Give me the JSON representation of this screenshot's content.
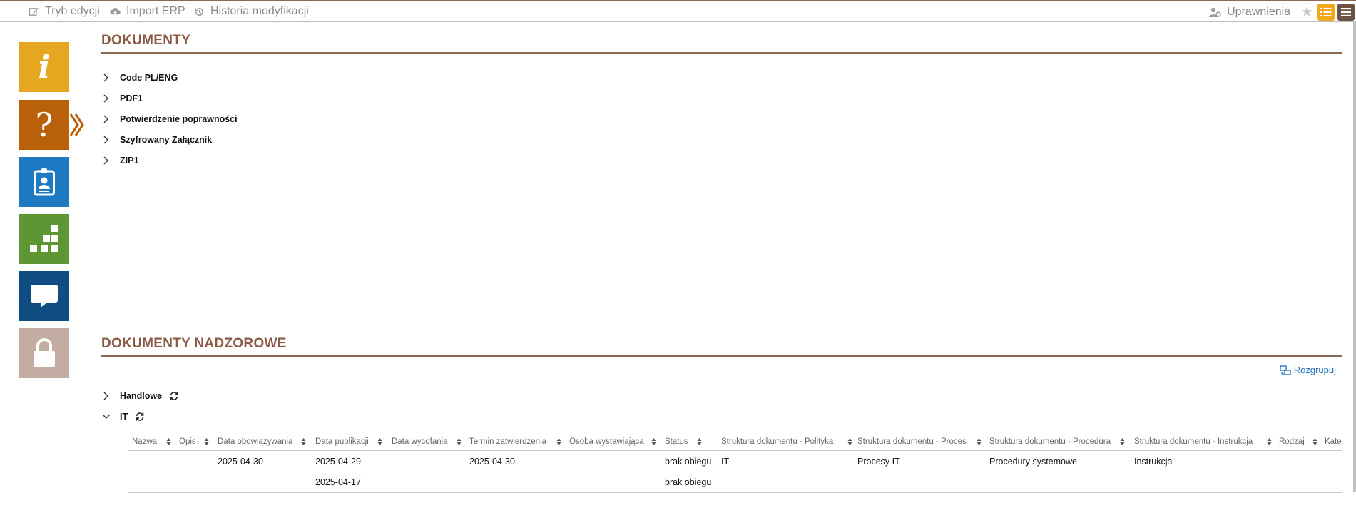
{
  "toolbar": {
    "edit_mode": "Tryb edycji",
    "import_erp": "Import ERP",
    "history": "Historia modyfikacji",
    "permissions": "Uprawnienia"
  },
  "colors": {
    "accent_brown": "#8a5a45",
    "tile_info": "#e6a620",
    "tile_help": "#b8610a",
    "tile_badge": "#1f7ac4",
    "tile_steps": "#5d9632",
    "tile_chat": "#0f4d82",
    "tile_lock": "#c3aca2",
    "link_blue": "#1f6fbf"
  },
  "sidebar": {
    "icons": [
      "info-icon",
      "help-icon",
      "badge-icon",
      "steps-icon",
      "chat-icon",
      "lock-icon"
    ],
    "info_glyph": "i",
    "help_glyph": "?"
  },
  "documents": {
    "title": "DOKUMENTY",
    "items": [
      "Code PL/ENG",
      "PDF1",
      "Potwierdzenie poprawności",
      "Szyfrowany Załącznik",
      "ZIP1"
    ]
  },
  "supervisory": {
    "title": "DOKUMENTY NADZOROWE",
    "ungroup_label": "Rozgrupuj",
    "groups": [
      {
        "label": "Handlowe",
        "expanded": false
      },
      {
        "label": "IT",
        "expanded": true
      }
    ],
    "columns": [
      "Nazwa",
      "Opis",
      "Data obowiązywania",
      "Data publikacji",
      "Data wycofania",
      "Termin zatwierdzenia",
      "Osoba wystawiająca",
      "Status",
      "Struktura dokumentu - Polityka",
      "Struktura dokumentu - Proces",
      "Struktura dokumentu - Procedura",
      "Struktura dokumentu - Instrukcja",
      "Rodzaj",
      "Kate"
    ],
    "rows": [
      {
        "data_obowiazywania": "2025-04-30",
        "data_publikacji": "2025-04-29",
        "termin_zatwierdzenia": "2025-04-30",
        "status": "brak obiegu",
        "polityka": "IT",
        "proces": "Procesy IT",
        "procedura": "Procedury systemowe",
        "instrukcja": "Instrukcja"
      },
      {
        "data_obowiazywania": "",
        "data_publikacji": "2025-04-17",
        "termin_zatwierdzenia": "",
        "status": "brak obiegu",
        "polityka": "",
        "proces": "",
        "procedura": "",
        "instrukcja": ""
      }
    ]
  }
}
